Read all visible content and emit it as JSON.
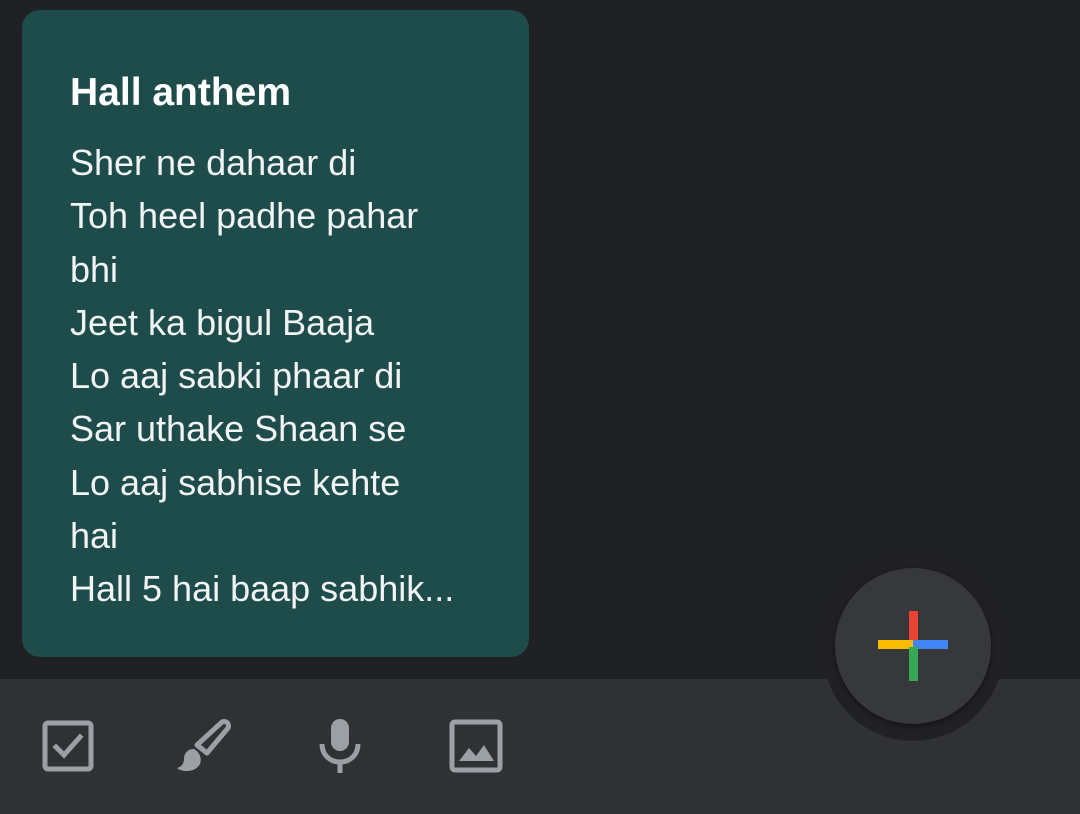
{
  "note": {
    "title": "Hall anthem",
    "lines": [
      "Sher ne dahaar di",
      "Toh heel padhe pahar",
      "bhi",
      "Jeet ka bigul Baaja",
      "Lo aaj sabki phaar di",
      "Sar uthake Shaan se",
      "Lo aaj sabhise kehte",
      "hai",
      "Hall 5 hai baap sabhik..."
    ],
    "background_color": "#1e4c4a"
  },
  "bottom_bar": {
    "background_color": "#303134",
    "icons": [
      "checkbox-icon",
      "brush-icon",
      "microphone-icon",
      "image-icon"
    ],
    "icon_color": "#9aa0a6"
  },
  "fab": {
    "icon": "plus-icon",
    "colors": {
      "red": "#ea4335",
      "yellow": "#fbbc04",
      "blue": "#4285f4",
      "green": "#34a853"
    }
  },
  "app_background_color": "#202124"
}
